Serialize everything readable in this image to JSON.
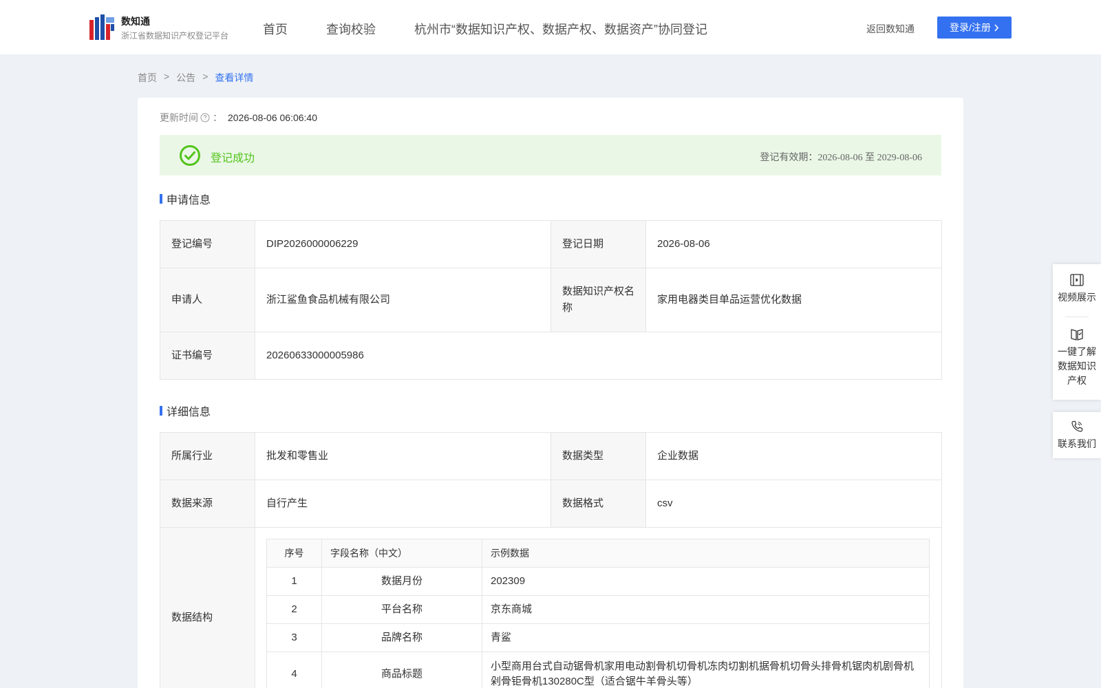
{
  "header": {
    "brand_name": "数知通",
    "brand_sub": "浙江省数据知识产权登记平台",
    "nav": [
      "首页",
      "查询校验",
      "杭州市“数据知识产权、数据产权、数据资产”协同登记"
    ],
    "return_label": "返回数知通",
    "login_label": "登录/注册"
  },
  "breadcrumb": [
    "首页",
    "公告",
    "查看详情"
  ],
  "breadcrumb_sep": ">",
  "update": {
    "label": "更新时间",
    "colon": "：",
    "value": "2026-08-06 06:06:40"
  },
  "status": {
    "text": "登记成功",
    "validity": "登记有效期：2026-08-06 至 2029-08-06",
    "color": "#52c41a"
  },
  "application_info": {
    "title": "申请信息",
    "reg_no_label": "登记编号",
    "reg_no": "DIP2026000006229",
    "reg_date_label": "登记日期",
    "reg_date": "2026-08-06",
    "applicant_label": "申请人",
    "applicant": "浙江鲨鱼食品机械有限公司",
    "ip_name_label": "数据知识产权名称",
    "ip_name": "家用电器类目单品运营优化数据",
    "cert_no_label": "证书编号",
    "cert_no": "20260633000005986"
  },
  "detail_info": {
    "title": "详细信息",
    "industry_label": "所属行业",
    "industry": "批发和零售业",
    "data_type_label": "数据类型",
    "data_type": "企业数据",
    "source_label": "数据来源",
    "source": "自行产生",
    "format_label": "数据格式",
    "format": "csv",
    "structure_label": "数据结构",
    "structure_headers": [
      "序号",
      "字段名称（中文）",
      "示例数据"
    ],
    "structure_rows": [
      [
        "1",
        "数据月份",
        "202309"
      ],
      [
        "2",
        "平台名称",
        "京东商城"
      ],
      [
        "3",
        "品牌名称",
        "青鲨"
      ],
      [
        "4",
        "商品标题",
        "小型商用台式自动锯骨机家用电动割骨机切骨机冻肉切割机据骨机切骨头排骨机锯肉机剧骨机剁骨钜骨机130280C型（适合锯牛羊骨头等）"
      ]
    ]
  },
  "float_bar": {
    "video": "视频展示",
    "learn": "一键了解数据知识产权",
    "contact": "联系我们"
  },
  "accent_color": "#3471f0"
}
